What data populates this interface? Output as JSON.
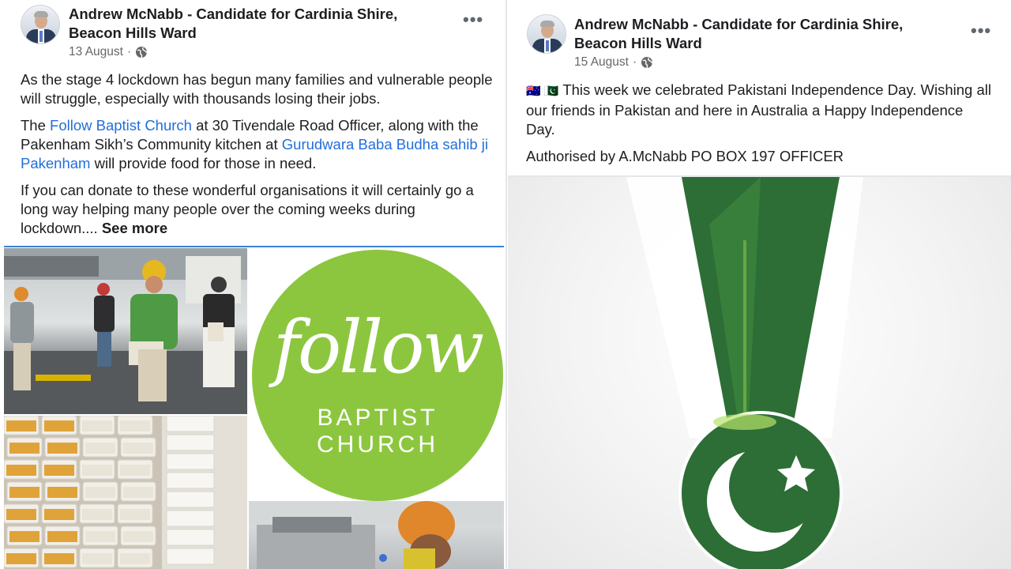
{
  "left_post": {
    "author": "Andrew McNabb - Candidate for Cardinia Shire, Beacon Hills Ward",
    "date": "13 August",
    "separator": "·",
    "privacy_icon": "globe-icon",
    "more_icon": "•••",
    "paragraph1": "As the stage 4 lockdown has begun many families and vulnerable people will struggle, especially with thousands losing their jobs.",
    "p2_text1": "The ",
    "p2_link1": "Follow Baptist Church",
    "p2_text2": " at 30 Tivendale Road Officer, along with the Pakenham Sikh’s Community kitchen at ",
    "p2_link2": "Gurudwara Baba Budha sahib ji Pakenham",
    "p2_text3": " will provide food for those in need.",
    "paragraph3": "If you can donate to these wonderful organisations it will certainly go a long way helping many people over the coming weeks during lockdown.... ",
    "see_more": "See more",
    "logo_script": "follow",
    "logo_line1": "BAPTIST",
    "logo_line2": "CHURCH"
  },
  "right_post": {
    "author": "Andrew McNabb - Candidate for Cardinia Shire, Beacon Hills Ward",
    "date": "15 August",
    "separator": "·",
    "privacy_icon": "globe-icon",
    "more_icon": "•••",
    "flags": "🇦🇺 🇵🇰",
    "paragraph1": "This week we celebrated Pakistani Independence Day. Wishing all our friends in Pakistan and here in Australia a Happy Independence Day.",
    "paragraph2": "Authorised by A.McNabb PO BOX 197 OFFICER"
  },
  "colors": {
    "link": "#216fdb",
    "follow_green": "#8cc63e",
    "pakistan_green": "#2c6e35",
    "meta_gray": "#65676b"
  }
}
